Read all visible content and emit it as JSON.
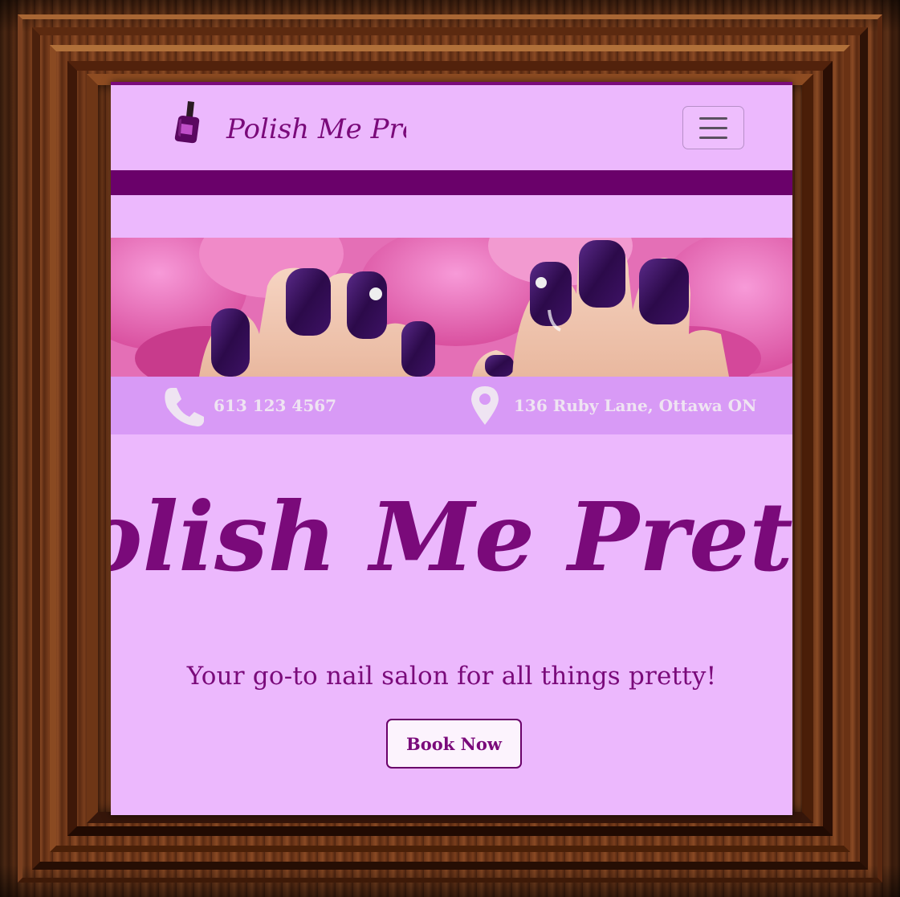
{
  "brand": {
    "name": "Polish Me Pretty",
    "logo_color": "#7a0a7a"
  },
  "navbar": {
    "toggler_icon": "hamburger-menu-icon"
  },
  "hero": {
    "image": "purple-painted-nails-on-pink-orchids"
  },
  "contact": {
    "phone": "613 123 4567",
    "address": "136 Ruby Lane, Ottawa ON",
    "phone_icon": "phone-icon",
    "address_icon": "map-pin-icon"
  },
  "main": {
    "title": "Polish Me Pretty",
    "tagline": "Your go-to nail salon for all things pretty!",
    "cta_label": "Book Now"
  },
  "colors": {
    "background": "#ecb8fd",
    "band": "#6a016a",
    "infobar": "#d89af6",
    "accent": "#7a0a7a"
  }
}
